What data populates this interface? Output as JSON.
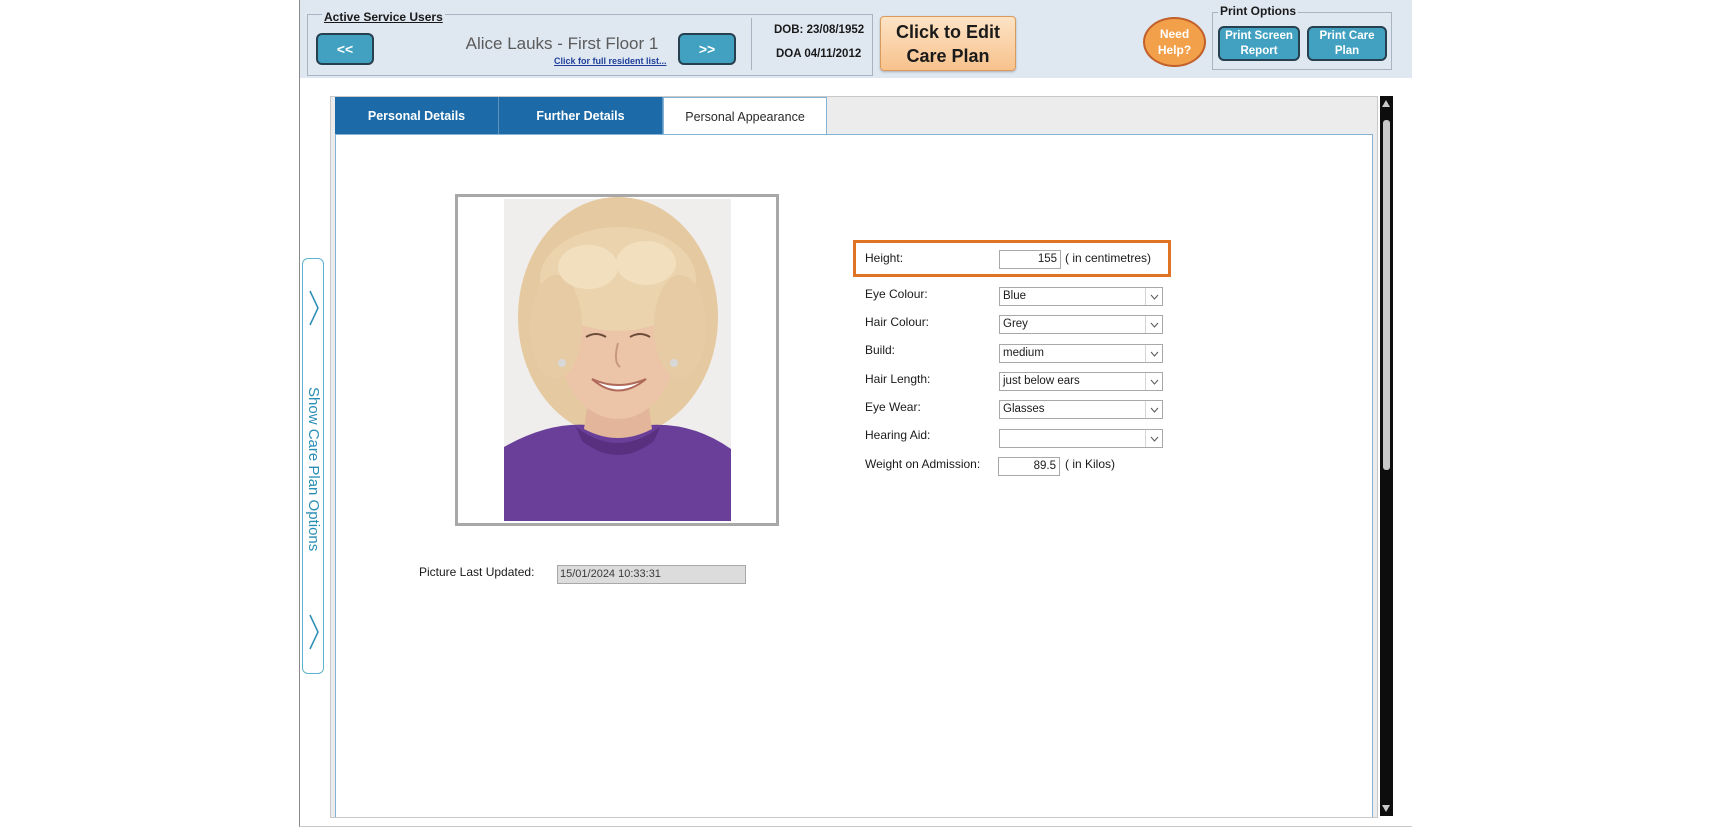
{
  "header": {
    "active_users_title": "Active Service Users",
    "prev_label": "<<",
    "next_label": ">>",
    "resident_name": "Alice Lauks - First Floor 1",
    "full_list_link": "Click for full resident list...",
    "dob": "DOB: 23/08/1952",
    "doa": "DOA 04/11/2012",
    "edit_line1": "Click to Edit",
    "edit_line2": "Care Plan",
    "help_line1": "Need",
    "help_line2": "Help?",
    "print_options_title": "Print Options",
    "print_screen_line1": "Print Screen",
    "print_screen_line2": "Report",
    "print_care_line1": "Print Care",
    "print_care_line2": "Plan"
  },
  "side_panel": {
    "label": "Show Care Plan Options"
  },
  "tabs": [
    {
      "label": "Personal Details"
    },
    {
      "label": "Further Details"
    },
    {
      "label": "Personal Appearance"
    }
  ],
  "appearance": {
    "height_label": "Height:",
    "height_value": "155",
    "height_unit": "( in centimetres)",
    "eye_colour_label": "Eye Colour:",
    "eye_colour_value": "Blue",
    "hair_colour_label": "Hair Colour:",
    "hair_colour_value": "Grey",
    "build_label": "Build:",
    "build_value": "medium",
    "hair_length_label": "Hair Length:",
    "hair_length_value": "just below ears",
    "eye_wear_label": "Eye Wear:",
    "eye_wear_value": "Glasses",
    "hearing_aid_label": "Hearing Aid:",
    "hearing_aid_value": "",
    "weight_label": "Weight on Admission:",
    "weight_value": "89.5",
    "weight_unit": "( in Kilos)",
    "picture_updated_label": "Picture Last Updated:",
    "picture_updated_value": "15/01/2024 10:33:31"
  },
  "colors": {
    "accent_blue": "#1c6aa7",
    "button_teal": "#42a1c0",
    "highlight_orange": "#de7424",
    "edit_button": "#f7c28c"
  }
}
